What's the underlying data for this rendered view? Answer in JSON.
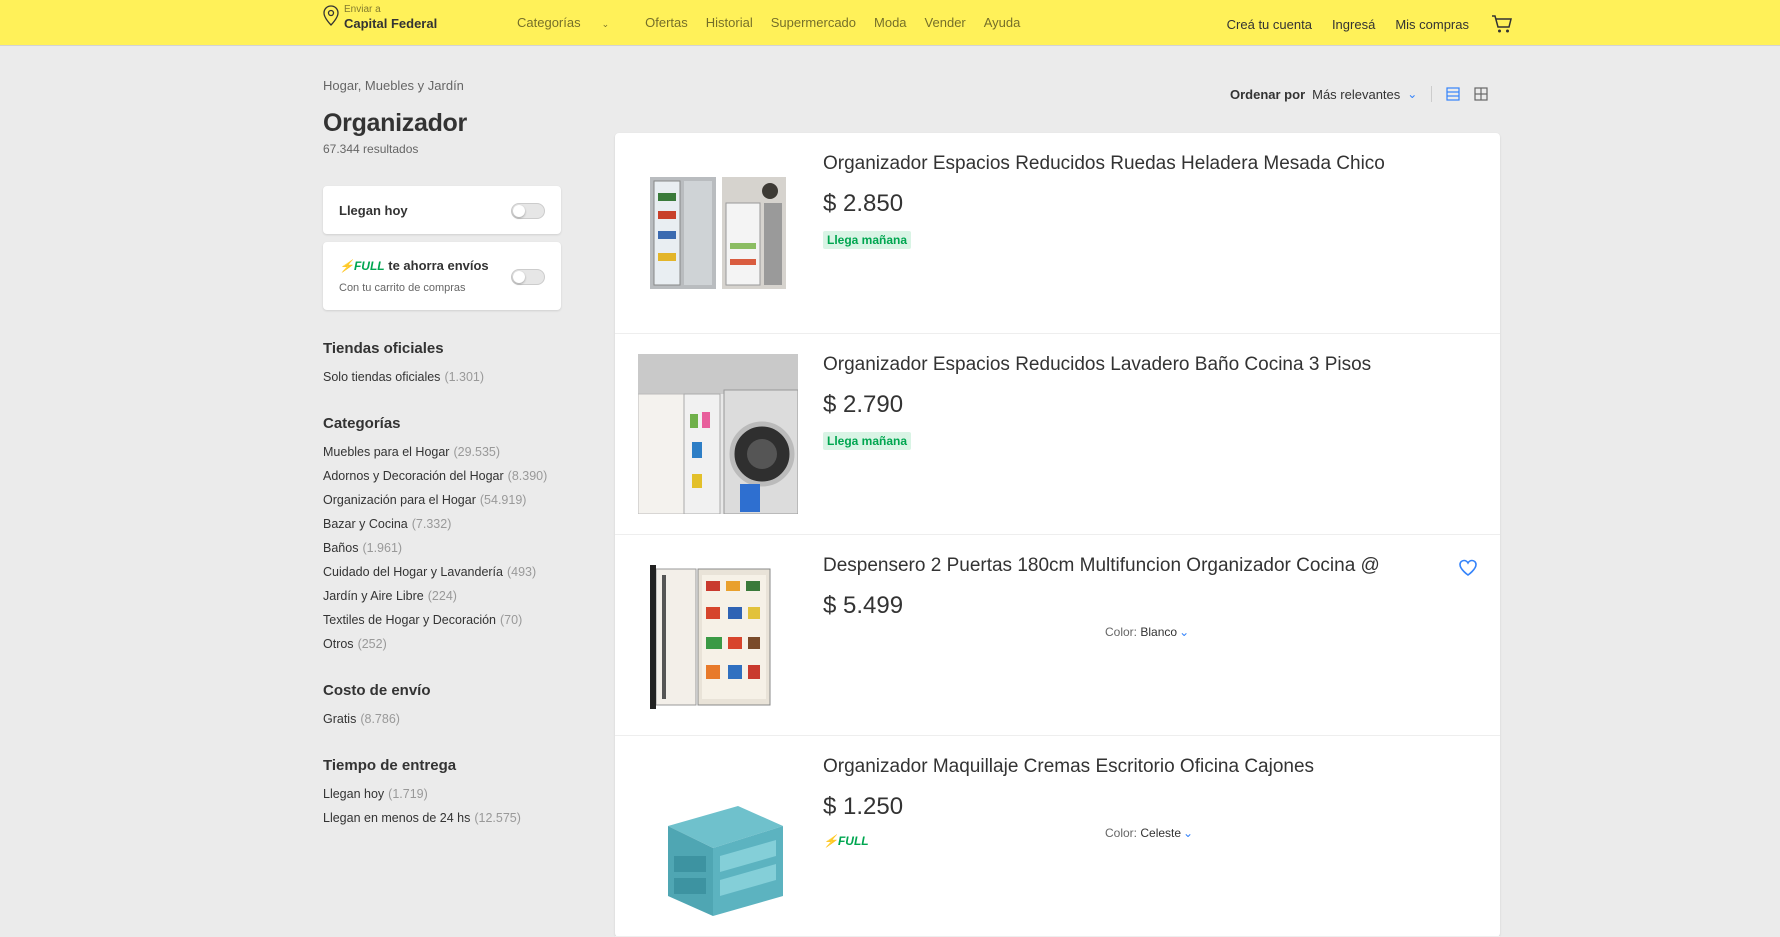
{
  "header": {
    "location_label": "Enviar a",
    "location_value": "Capital Federal",
    "nav": [
      "Categorías",
      "Ofertas",
      "Historial",
      "Supermercado",
      "Moda",
      "Vender",
      "Ayuda"
    ],
    "account": [
      "Creá tu cuenta",
      "Ingresá",
      "Mis compras"
    ]
  },
  "page": {
    "breadcrumb": "Hogar, Muebles y Jardín",
    "title": "Organizador",
    "results": "67.344 resultados"
  },
  "toggles": {
    "today": "Llegan hoy",
    "full_tag": "FULL",
    "full_text": "te ahorra envíos",
    "full_sub": "Con tu carrito de compras"
  },
  "filters": [
    {
      "title": "Tiendas oficiales",
      "items": [
        {
          "label": "Solo tiendas oficiales",
          "count": "(1.301)"
        }
      ]
    },
    {
      "title": "Categorías",
      "items": [
        {
          "label": "Muebles para el Hogar",
          "count": "(29.535)"
        },
        {
          "label": "Adornos y Decoración del Hogar",
          "count": "(8.390)"
        },
        {
          "label": "Organización para el Hogar",
          "count": "(54.919)"
        },
        {
          "label": "Bazar y Cocina",
          "count": "(7.332)"
        },
        {
          "label": "Baños",
          "count": "(1.961)"
        },
        {
          "label": "Cuidado del Hogar y Lavandería",
          "count": "(493)"
        },
        {
          "label": "Jardín y Aire Libre",
          "count": "(224)"
        },
        {
          "label": "Textiles de Hogar y Decoración",
          "count": "(70)"
        },
        {
          "label": "Otros",
          "count": "(252)"
        }
      ]
    },
    {
      "title": "Costo de envío",
      "items": [
        {
          "label": "Gratis",
          "count": "(8.786)"
        }
      ]
    },
    {
      "title": "Tiempo de entrega",
      "items": [
        {
          "label": "Llegan hoy",
          "count": "(1.719)"
        },
        {
          "label": "Llegan en menos de 24 hs",
          "count": "(12.575)"
        }
      ]
    }
  ],
  "sort": {
    "label": "Ordenar por",
    "value": "Más relevantes"
  },
  "items": [
    {
      "title": "Organizador Espacios Reducidos Ruedas Heladera Mesada Chico",
      "price": "$ 2.850",
      "shipping": "Llega mañana",
      "full": "",
      "color_label": "",
      "color_value": "",
      "fav": false,
      "thumb": "fridge"
    },
    {
      "title": "Organizador Espacios Reducidos Lavadero Baño Cocina 3 Pisos",
      "price": "$ 2.790",
      "shipping": "Llega mañana",
      "full": "",
      "color_label": "",
      "color_value": "",
      "fav": false,
      "thumb": "laundry"
    },
    {
      "title": "Despensero 2 Puertas 180cm Multifuncion Organizador Cocina @",
      "price": "$ 5.499",
      "shipping": "",
      "full": "",
      "color_label": "Color:",
      "color_value": "Blanco",
      "fav": true,
      "thumb": "pantry"
    },
    {
      "title": "Organizador Maquillaje Cremas Escritorio Oficina Cajones",
      "price": "$ 1.250",
      "shipping": "",
      "full": "FULL",
      "color_label": "Color:",
      "color_value": "Celeste",
      "fav": false,
      "thumb": "drawers"
    }
  ],
  "colors": {
    "header_bg": "#fff159",
    "page_bg": "#ebebeb",
    "accent": "#3483fa",
    "green": "#00a650"
  }
}
